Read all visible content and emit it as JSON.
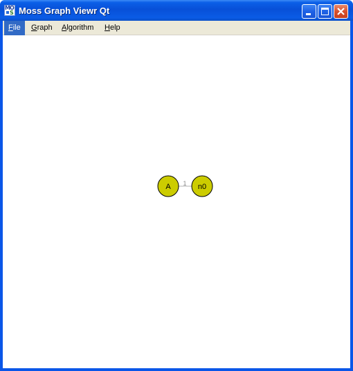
{
  "window": {
    "title": "Moss Graph Viewr Qt",
    "icon": "moss-app-icon",
    "icon_letters": [
      "M",
      "O",
      "S"
    ],
    "controls": [
      "minimize-icon",
      "maximize-icon",
      "close-icon"
    ]
  },
  "menu": {
    "items": [
      {
        "label": "File",
        "mnemonic": "F",
        "rest": "ile",
        "active": true
      },
      {
        "label": "Graph",
        "mnemonic": "G",
        "rest": "raph",
        "active": false
      },
      {
        "label": "Algorithm",
        "mnemonic": "A",
        "rest": "lgorithm",
        "active": false
      },
      {
        "label": "Help",
        "mnemonic": "H",
        "rest": "elp",
        "active": false
      }
    ]
  },
  "graph": {
    "nodes": [
      {
        "id": "A",
        "label": "A"
      },
      {
        "id": "n0",
        "label": "n0"
      }
    ],
    "edges": [
      {
        "from": "A",
        "to": "n0",
        "label": "1"
      }
    ],
    "colors": {
      "node_fill": "#cccc00",
      "node_stroke": "#000000",
      "edge": "#b0b0b0",
      "titlebar": "#0a56e8",
      "menu_active": "#316ac5",
      "close_button": "#d9502c"
    }
  }
}
